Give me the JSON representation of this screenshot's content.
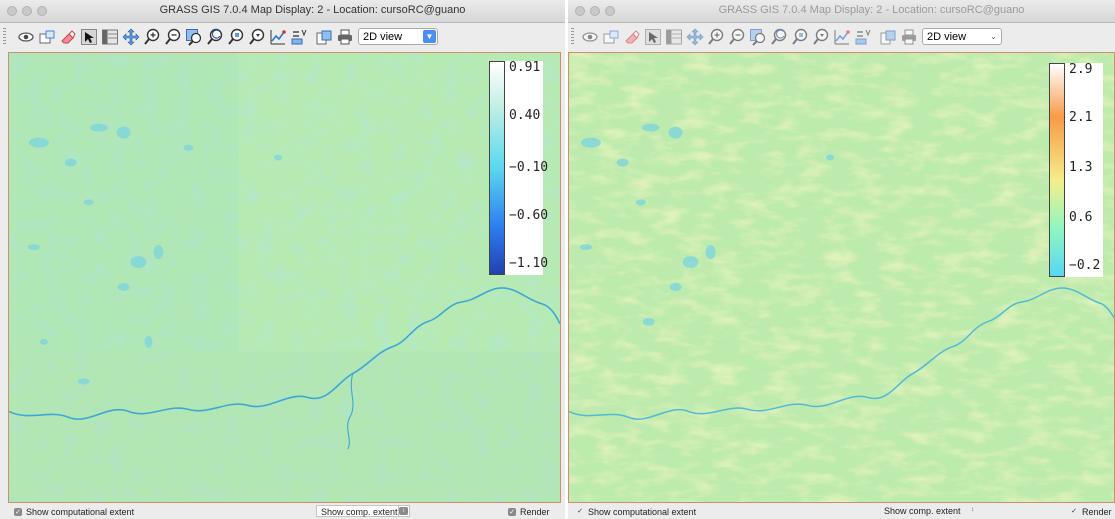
{
  "windows": [
    {
      "title": "GRASS GIS 7.0.4 Map Display: 2 - Location: cursoRC@guano",
      "view_mode": "2D view",
      "legend": {
        "labels": [
          "0.91",
          "0.40",
          "−0.10",
          "−0.60",
          "−1.10"
        ],
        "colors": [
          "#ffffff",
          "#5ad8ee",
          "#2d7df0",
          "#2241b0"
        ]
      },
      "status": {
        "show_extent_label": "Show computational extent",
        "combo_value": "Show comp. extent",
        "render_label": "Render"
      }
    },
    {
      "title": "GRASS GIS 7.0.4 Map Display: 2 - Location: cursoRC@guano",
      "view_mode": "2D view",
      "legend": {
        "labels": [
          "2.9",
          "2.1",
          "1.3",
          "0.6",
          "−0.2"
        ],
        "colors": [
          "#ffffff",
          "#f99a48",
          "#f5ee8a",
          "#8ef6c2",
          "#58d6f4"
        ]
      },
      "status": {
        "show_extent_label": "Show computational extent",
        "combo_value": "Show comp. extent",
        "render_label": "Render"
      }
    }
  ],
  "toolbar_icons": [
    "display-icon",
    "render-icon",
    "erase-icon",
    "pointer-icon",
    "query-icon",
    "pan-icon",
    "zoom-in-icon",
    "zoom-out-icon",
    "zoom-extent-icon",
    "zoom-back-icon",
    "zoom-options-icon",
    "zoom-menu-icon",
    "analyze-icon",
    "overlay-icon",
    "save-image-icon",
    "print-icon"
  ]
}
